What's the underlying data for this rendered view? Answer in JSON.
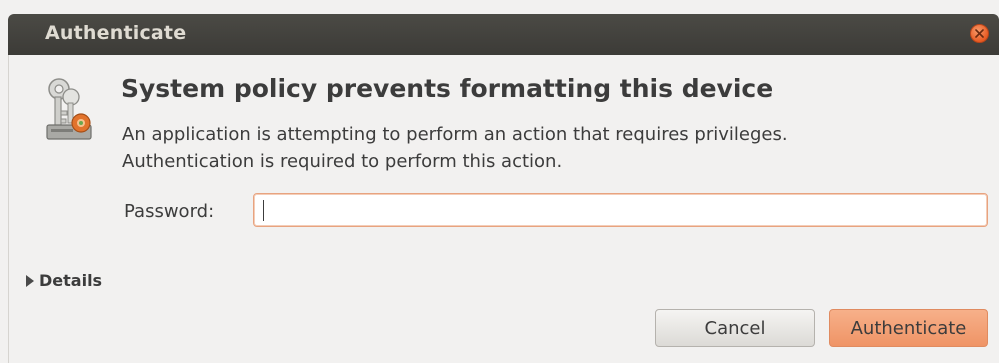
{
  "window": {
    "title": "Authenticate",
    "close_icon": "close-icon"
  },
  "dialog": {
    "icon": "keys-gear-icon",
    "heading": "System policy prevents formatting this device",
    "message_line1": "An application is attempting to perform an action that requires privileges.",
    "message_line2": "Authentication is required to perform this action.",
    "password_label": "Password:",
    "password_value": "",
    "details_label": "Details",
    "details_icon": "disclosure-triangle-right-icon"
  },
  "buttons": {
    "cancel_label": "Cancel",
    "authenticate_label": "Authenticate"
  },
  "colors": {
    "titlebar": "#3c3b37",
    "title_text": "#dfdbd2",
    "close_button": "#e85a22",
    "authenticate_button": "#ef9466",
    "input_focus_border": "#e8a37f",
    "background": "#f2f1f0"
  }
}
